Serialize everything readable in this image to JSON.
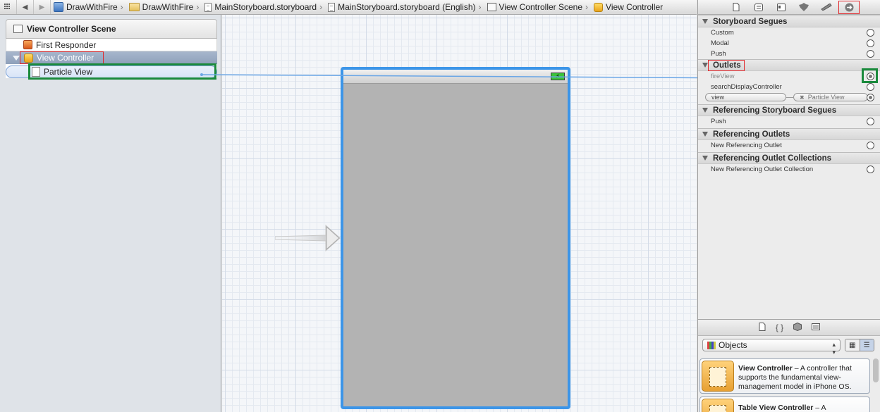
{
  "jumpbar": {
    "crumbs": [
      {
        "label": "DrawWithFire",
        "icon": "project-icon"
      },
      {
        "label": "DrawWithFire",
        "icon": "folder-icon"
      },
      {
        "label": "MainStoryboard.storyboard",
        "icon": "storyboard-file-icon"
      },
      {
        "label": "MainStoryboard.storyboard (English)",
        "icon": "storyboard-file-icon"
      },
      {
        "label": "View Controller Scene",
        "icon": "scene-icon"
      },
      {
        "label": "View Controller",
        "icon": "view-controller-icon"
      }
    ]
  },
  "outline": {
    "title": "View Controller Scene",
    "items": [
      "First Responder",
      "View Controller",
      "Particle View"
    ]
  },
  "inspector": {
    "sections": {
      "segues": {
        "title": "Storyboard Segues",
        "rows": [
          "Custom",
          "Modal",
          "Push"
        ]
      },
      "outlets": {
        "title": "Outlets",
        "rows": [
          "fireView",
          "searchDisplayController"
        ],
        "view_label": "view",
        "view_target": "Particle View"
      },
      "ref_segues": {
        "title": "Referencing Storyboard Segues",
        "rows": [
          "Push"
        ]
      },
      "ref_outlets": {
        "title": "Referencing Outlets",
        "rows": [
          "New Referencing Outlet"
        ]
      },
      "ref_collections": {
        "title": "Referencing Outlet Collections",
        "rows": [
          "New Referencing Outlet Collection"
        ]
      }
    }
  },
  "library": {
    "selector_value": "Objects",
    "items": [
      {
        "title": "View Controller",
        "desc": " – A controller that supports the fundamental view-management model in iPhone OS."
      },
      {
        "title": "Table View Controller",
        "desc": " – A"
      }
    ]
  },
  "colors": {
    "accent_blue": "#3c95e8",
    "annotation_red": "#e0262a",
    "annotation_green": "#1a8a3c",
    "selection": "#8fa1bb"
  }
}
